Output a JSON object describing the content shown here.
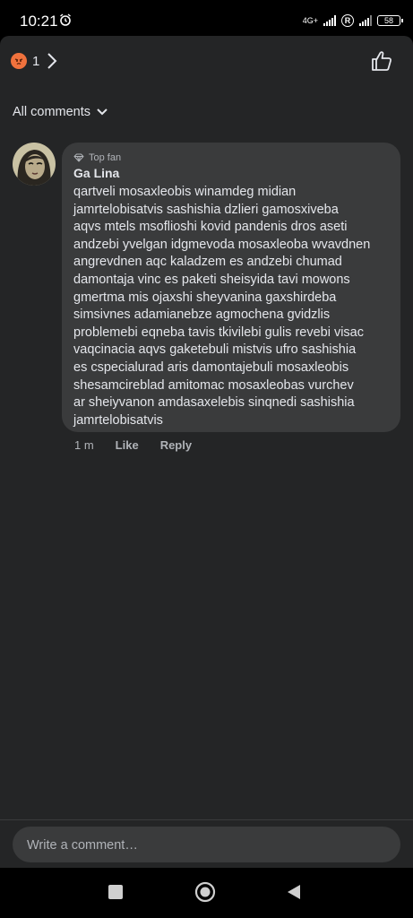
{
  "status_bar": {
    "time": "10:21",
    "network": "4G+",
    "battery": "58"
  },
  "header": {
    "reaction_emoji": "angry-reaction",
    "reaction_count": "1"
  },
  "filter": {
    "label": "All comments"
  },
  "comment": {
    "badge": "Top fan",
    "author": "Ga Lina",
    "text": "qartveli mosaxleobis winamdeg midian\njamrtelobisatvis sashishia dzlieri gamosxiveba\naqvs mtels msoflioshi kovid pandenis dros aseti\nandzebi yvelgan idgmevoda mosaxleoba wvavdnen\nangrevdnen aqc kaladzem es andzebi chumad\ndamontaja vinc es paketi sheisyida tavi mowons\ngmertma mis ojaxshi sheyvanina gaxshirdeba\nsimsivnes adamianebze agmochena gvidzlis\nproblemebi eqneba tavis tkivilebi gulis revebi visac\nvaqcinacia aqvs gaketebuli mistvis ufro sashishia\nes cspecialurad aris damontajebuli mosaxleobis\nshesamcireblad amitomac mosaxleobas vurchev\nar sheiyvanon amdasaxelebis sinqnedi sashishia\njamrtelobisatvis",
    "time": "1 m",
    "like_label": "Like",
    "reply_label": "Reply"
  },
  "composer": {
    "placeholder": "Write a comment…"
  },
  "colors": {
    "sheet_bg": "#242526",
    "bubble_bg": "#3a3b3c",
    "text": "#e4e6eb",
    "secondary_text": "#b0b3b8",
    "reaction": "#f0723d"
  }
}
